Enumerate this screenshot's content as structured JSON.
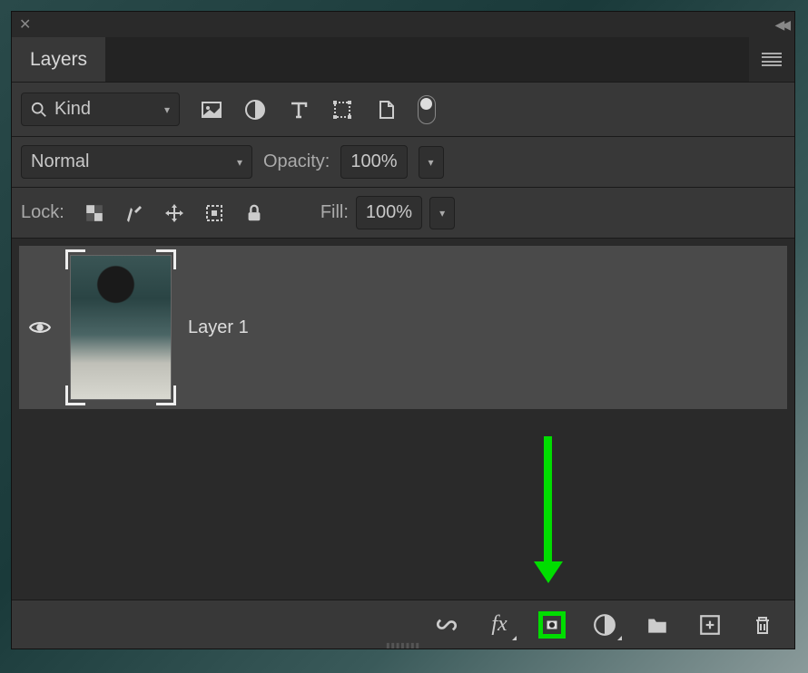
{
  "tab": {
    "label": "Layers"
  },
  "filter": {
    "kind_label": "Kind"
  },
  "blend": {
    "mode": "Normal",
    "opacity_label": "Opacity:",
    "opacity_value": "100%"
  },
  "lock": {
    "label": "Lock:",
    "fill_label": "Fill:",
    "fill_value": "100%"
  },
  "layers": [
    {
      "name": "Layer 1",
      "visible": true
    }
  ]
}
